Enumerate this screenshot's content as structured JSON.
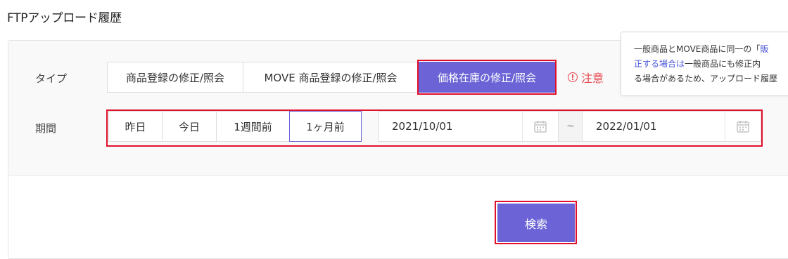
{
  "page": {
    "title": "FTPアップロード履歴"
  },
  "type_row": {
    "label": "タイプ",
    "options": [
      "商品登録の修正/照会",
      "MOVE 商品登録の修正/照会",
      "価格在庫の修正/照会"
    ],
    "selected": "価格在庫の修正/照会"
  },
  "notice": {
    "label": "注意",
    "icon": "exclamation-circle-icon",
    "tooltip": {
      "line1_a": "一般商品とMOVE商品に同一の「",
      "line1_b": "販",
      "line2_a": "正する場合は",
      "line2_b": "一般商品にも修正内",
      "line3": "る場合があるため、アップロード履歴"
    }
  },
  "period_row": {
    "label": "期間",
    "quick_options": [
      "昨日",
      "今日",
      "1週間前",
      "1ヶ月前"
    ],
    "selected": "1ヶ月前",
    "start_date": "2021/10/01",
    "end_date": "2022/01/01",
    "separator": "~",
    "calendar_icon": "calendar-icon"
  },
  "search_button": {
    "label": "検索"
  },
  "colors": {
    "accent": "#6c64d6",
    "highlight_outline": "#e0102a",
    "notice": "#e5484d",
    "link": "#4b57d8"
  }
}
